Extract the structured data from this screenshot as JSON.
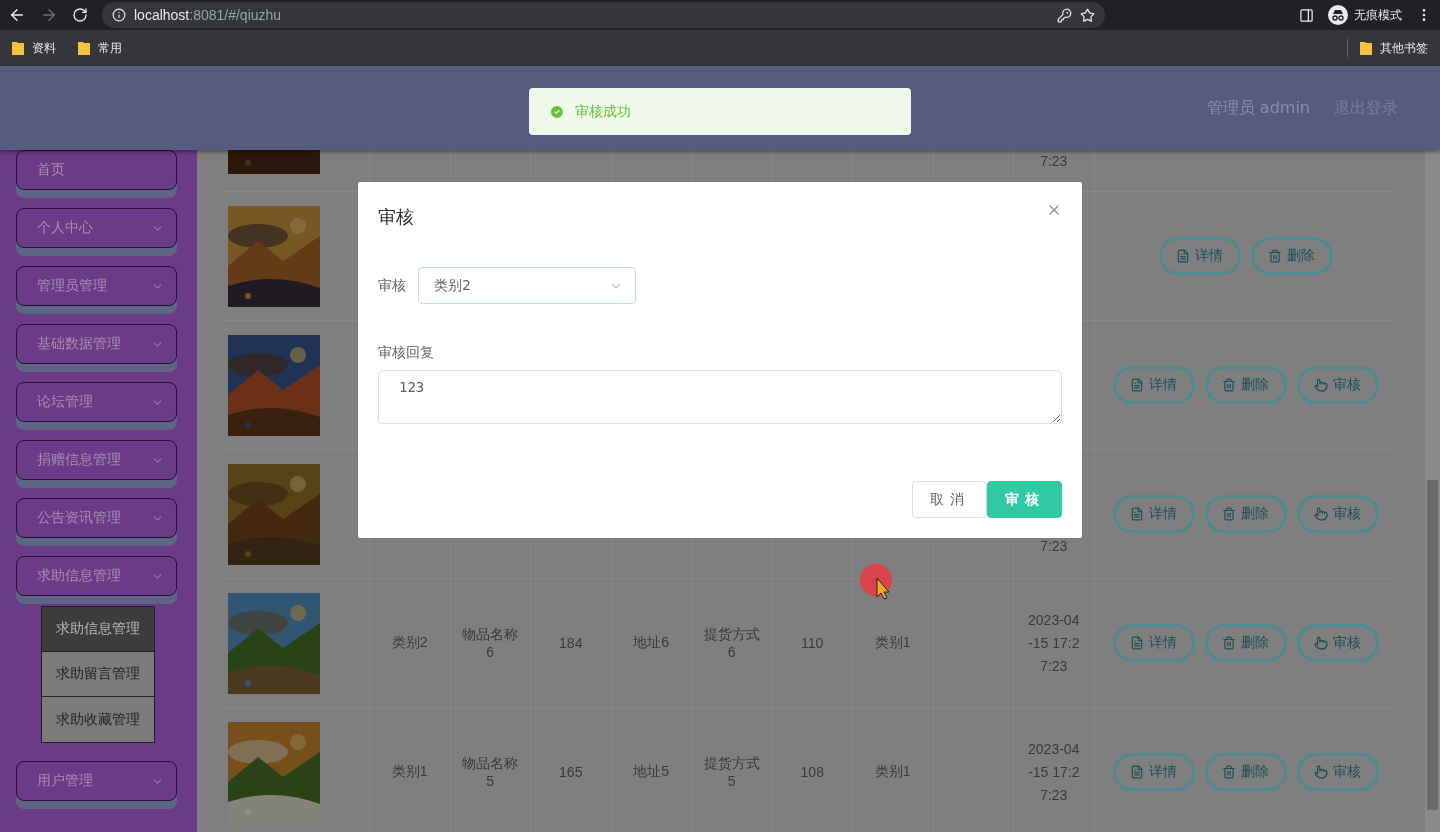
{
  "browser": {
    "url_host": "localhost",
    "url_path": ":8081/#/qiuzhu",
    "profile_label": "无痕模式",
    "bookmarks": [
      {
        "label": "资料"
      },
      {
        "label": "常用"
      }
    ],
    "other_bookmarks": "其他书签"
  },
  "header": {
    "user": "管理员 admin",
    "logout": "退出登录"
  },
  "toast": {
    "kind": "success",
    "message": "审核成功"
  },
  "sidebar": {
    "items": [
      {
        "label": "首页",
        "expandable": false
      },
      {
        "label": "个人中心",
        "expandable": true
      },
      {
        "label": "管理员管理",
        "expandable": true
      },
      {
        "label": "基础数据管理",
        "expandable": true
      },
      {
        "label": "论坛管理",
        "expandable": true
      },
      {
        "label": "捐赠信息管理",
        "expandable": true
      },
      {
        "label": "公告资讯管理",
        "expandable": true
      },
      {
        "label": "求助信息管理",
        "expandable": true,
        "expanded": true,
        "children": [
          {
            "label": "求助信息管理",
            "selected": true
          },
          {
            "label": "求助留言管理",
            "selected": false
          },
          {
            "label": "求助收藏管理",
            "selected": false
          }
        ]
      },
      {
        "label": "用户管理",
        "expandable": true
      }
    ]
  },
  "table": {
    "rows": [
      {
        "kind": "cut_top",
        "date": "7:23"
      },
      {
        "kind": "under_dialog",
        "actions": [
          {
            "kind": "detail",
            "label": "详情"
          },
          {
            "kind": "delete",
            "label": "删除"
          }
        ]
      },
      {
        "kind": "under_dialog",
        "actions": [
          {
            "kind": "detail",
            "label": "详情"
          },
          {
            "kind": "delete",
            "label": "删除"
          },
          {
            "kind": "review",
            "label": "审核"
          }
        ]
      },
      {
        "kind": "under_dialog",
        "date": "7:23",
        "actions": [
          {
            "kind": "detail",
            "label": "详情"
          },
          {
            "kind": "delete",
            "label": "删除"
          },
          {
            "kind": "review",
            "label": "审核"
          }
        ]
      },
      {
        "kind": "full",
        "cells": [
          "类别2",
          "物品名称6",
          "184",
          "地址6",
          "提货方式6",
          "110",
          "类别1",
          ""
        ],
        "date": "2023-04-15 17:27:23",
        "actions": [
          {
            "kind": "detail",
            "label": "详情"
          },
          {
            "kind": "delete",
            "label": "删除"
          },
          {
            "kind": "review",
            "label": "审核"
          }
        ]
      },
      {
        "kind": "full",
        "cells": [
          "类别1",
          "物品名称5",
          "165",
          "地址5",
          "提货方式5",
          "108",
          "类别1",
          ""
        ],
        "date": "2023-04-15 17:27:23",
        "actions": [
          {
            "kind": "detail",
            "label": "详情"
          },
          {
            "kind": "delete",
            "label": "删除"
          },
          {
            "kind": "review",
            "label": "审核"
          }
        ]
      }
    ]
  },
  "dialog": {
    "title": "审核",
    "fields": [
      {
        "kind": "select",
        "label": "审核",
        "value": "类别2"
      },
      {
        "kind": "textarea",
        "label": "审核回复",
        "value": "123"
      }
    ],
    "buttons": [
      {
        "kind": "cancel",
        "label": "取消"
      },
      {
        "kind": "primary",
        "label": "审核"
      }
    ]
  }
}
